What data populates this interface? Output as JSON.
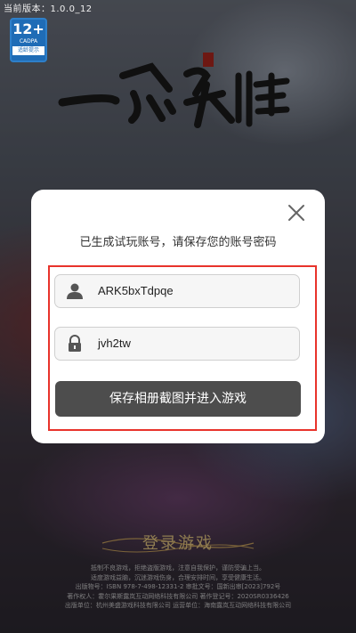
{
  "header": {
    "version_text": "当前版本：1.0.0_12",
    "age_rating": {
      "number": "12+",
      "org": "CADPA",
      "hint": "适龄提示"
    }
  },
  "logo": {
    "text": "一念永恒",
    "seal_text": "圣美"
  },
  "dialog": {
    "title": "已生成试玩账号，请保存您的账号密码",
    "account": {
      "value": "ARK5bxTdpqe",
      "icon": "user-icon"
    },
    "password": {
      "value": "jvh2tw",
      "icon": "lock-icon"
    },
    "submit_label": "保存相册截图并进入游戏",
    "highlight_color": "#e8332b"
  },
  "login": {
    "label": "登录游戏"
  },
  "footer": {
    "lines": [
      "抵制不良游戏，拒绝盗版游戏，注意自我保护，谨防受骗上当。",
      "适度游戏益脑，沉迷游戏伤身，合理安排时间，享受健康生活。",
      "出版物号：ISBN 978-7-498-12331-2  审批文号：国新出审[2023]792号",
      "著作权人：霍尔果斯露岚互动网络科技有限公司  著作登记号：2020SR0336426",
      "出版单位：杭州美盛游戏科技有限公司  运营单位：海南露岚互动网络科技有限公司"
    ]
  }
}
